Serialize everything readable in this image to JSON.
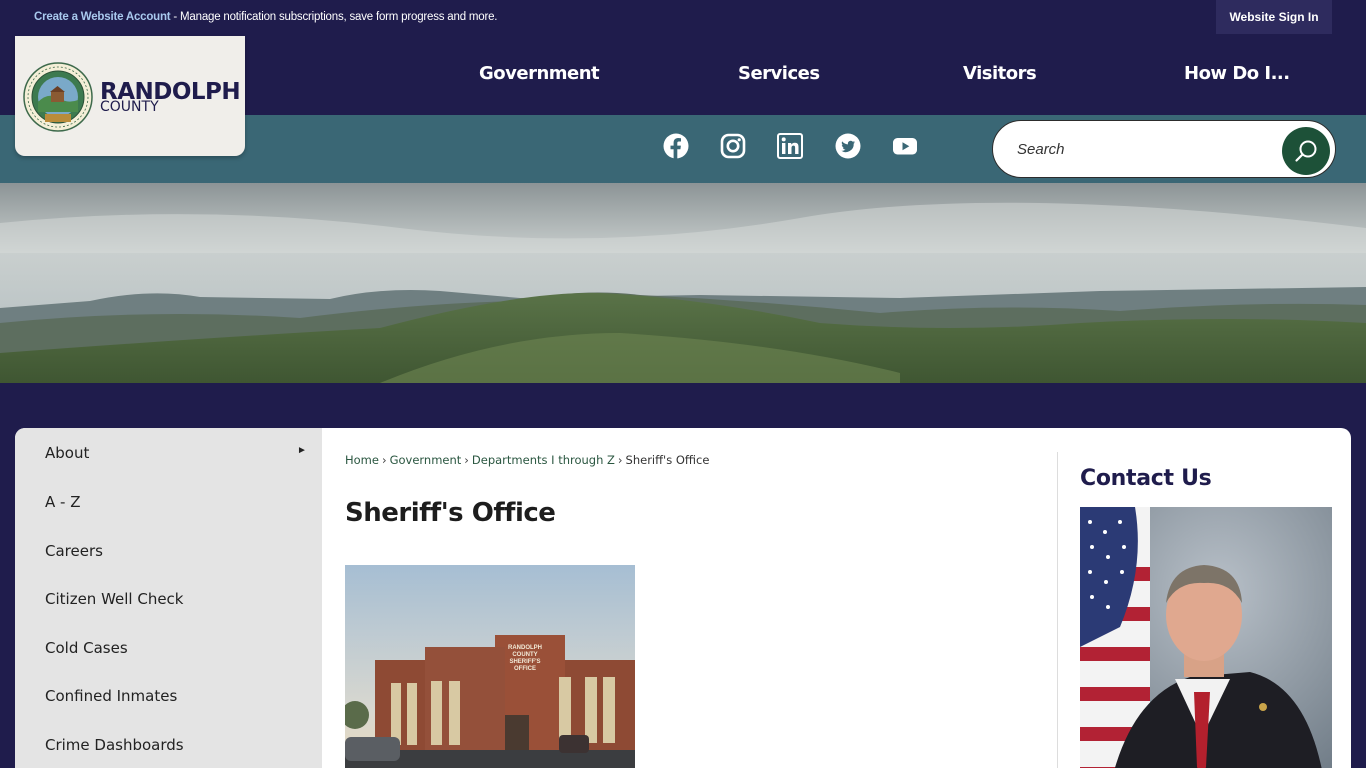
{
  "topbar": {
    "account_link": "Create a Website Account",
    "account_text": " - Manage notification subscriptions, save form progress and more.",
    "signin_label": "Website Sign In"
  },
  "logo": {
    "name": "RANDOLPH",
    "county": "COUNTY"
  },
  "nav": {
    "items": [
      "Government",
      "Services",
      "Visitors",
      "How Do I..."
    ]
  },
  "social": {
    "icons": [
      "facebook-icon",
      "instagram-icon",
      "linkedin-icon",
      "twitter-icon",
      "youtube-icon"
    ]
  },
  "search": {
    "placeholder": "Search"
  },
  "sidenav": {
    "items": [
      "About",
      "A - Z",
      "Careers",
      "Citizen Well Check",
      "Cold Cases",
      "Confined Inmates",
      "Crime Dashboards"
    ]
  },
  "breadcrumb": {
    "items": [
      "Home",
      "Government",
      "Departments I through Z",
      "Sheriff's Office"
    ],
    "separator": "›"
  },
  "page": {
    "title": "Sheriff's Office",
    "building_sign": [
      "RANDOLPH",
      "COUNTY",
      "SHERIFF'S",
      "OFFICE"
    ]
  },
  "contact": {
    "title": "Contact Us"
  },
  "colors": {
    "navy": "#1f1c4c",
    "teal": "#3a6775",
    "green": "#1d5138"
  }
}
